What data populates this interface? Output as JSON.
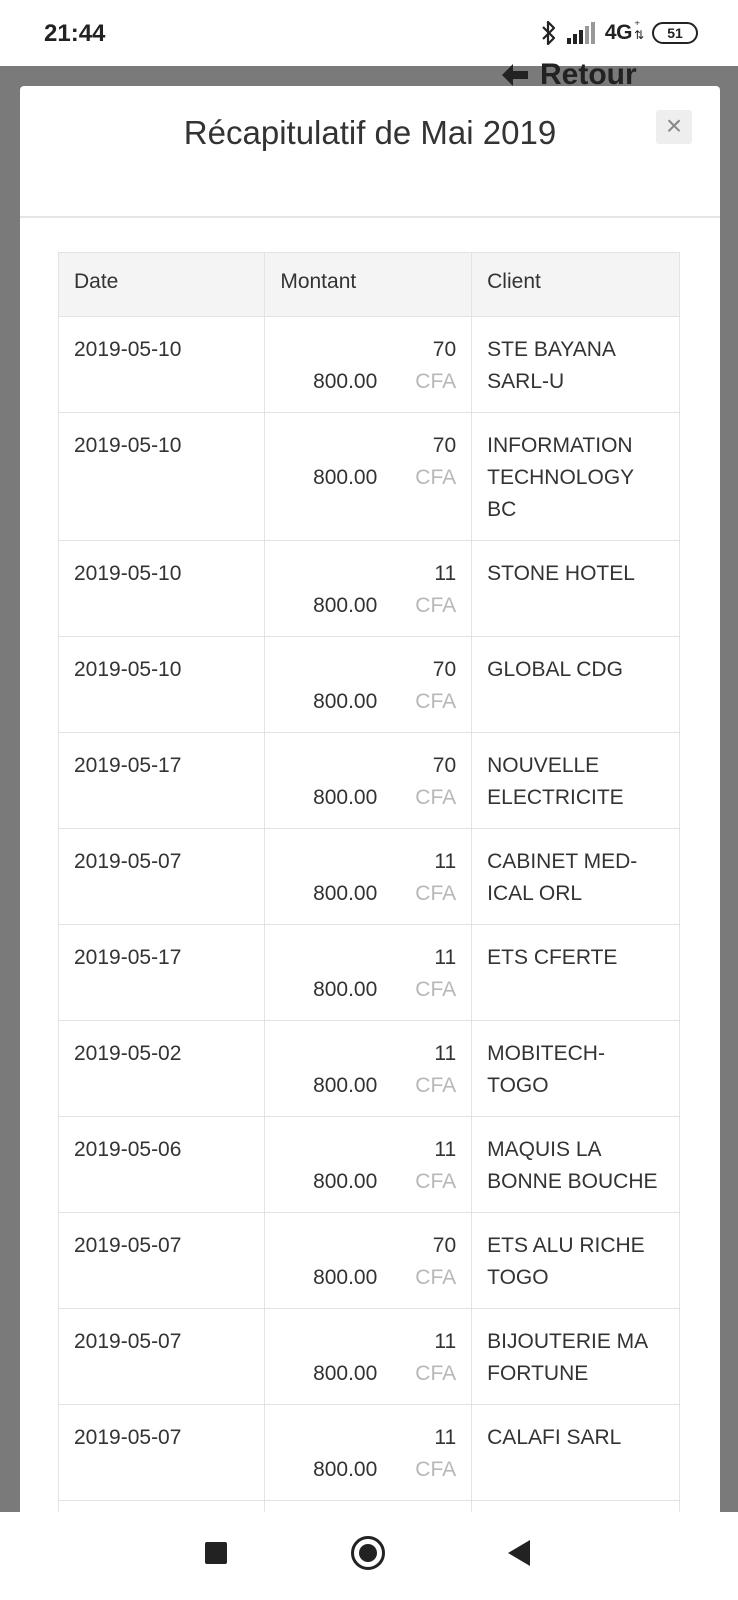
{
  "status": {
    "time": "21:44",
    "network": "4G",
    "battery": "51"
  },
  "backdrop": {
    "back_label": "Retour"
  },
  "modal": {
    "title": "Récapitulatif de Mai 2019",
    "close_symbol": "×"
  },
  "table": {
    "headers": [
      "Date",
      "Montant",
      "Client"
    ],
    "rows": [
      {
        "date": "2019-05-10",
        "amount_top": "70",
        "amount_bottom": "800.00",
        "currency": "CFA",
        "client": "STE BAYANA SARL-U"
      },
      {
        "date": "2019-05-10",
        "amount_top": "70",
        "amount_bottom": "800.00",
        "currency": "CFA",
        "client": "INFORMATION TECHNOLOGY BC"
      },
      {
        "date": "2019-05-10",
        "amount_top": "11",
        "amount_bottom": "800.00",
        "currency": "CFA",
        "client": "STONE HOTEL"
      },
      {
        "date": "2019-05-10",
        "amount_top": "70",
        "amount_bottom": "800.00",
        "currency": "CFA",
        "client": "GLOBAL CDG"
      },
      {
        "date": "2019-05-17",
        "amount_top": "70",
        "amount_bottom": "800.00",
        "currency": "CFA",
        "client": "NOUVELLE ELECTRICITE"
      },
      {
        "date": "2019-05-07",
        "amount_top": "11",
        "amount_bottom": "800.00",
        "currency": "CFA",
        "client": "CABINET MED-ICAL ORL"
      },
      {
        "date": "2019-05-17",
        "amount_top": "11",
        "amount_bottom": "800.00",
        "currency": "CFA",
        "client": "ETS CFERTE"
      },
      {
        "date": "2019-05-02",
        "amount_top": "11",
        "amount_bottom": "800.00",
        "currency": "CFA",
        "client": "MOBITECH-TOGO"
      },
      {
        "date": "2019-05-06",
        "amount_top": "11",
        "amount_bottom": "800.00",
        "currency": "CFA",
        "client": "MAQUIS LA BONNE BOUCHE"
      },
      {
        "date": "2019-05-07",
        "amount_top": "70",
        "amount_bottom": "800.00",
        "currency": "CFA",
        "client": "ETS ALU RICHE TOGO"
      },
      {
        "date": "2019-05-07",
        "amount_top": "11",
        "amount_bottom": "800.00",
        "currency": "CFA",
        "client": "BIJOUTERIE MA FORTUNE"
      },
      {
        "date": "2019-05-07",
        "amount_top": "11",
        "amount_bottom": "800.00",
        "currency": "CFA",
        "client": "CALAFI SARL"
      }
    ]
  },
  "icons": {
    "bluetooth": "bluetooth-icon",
    "signal": "signal-icon",
    "battery": "battery-icon",
    "back_arrow": "arrow-left-icon",
    "nav_recents": "square-icon",
    "nav_home": "circle-icon",
    "nav_back": "triangle-back-icon"
  }
}
